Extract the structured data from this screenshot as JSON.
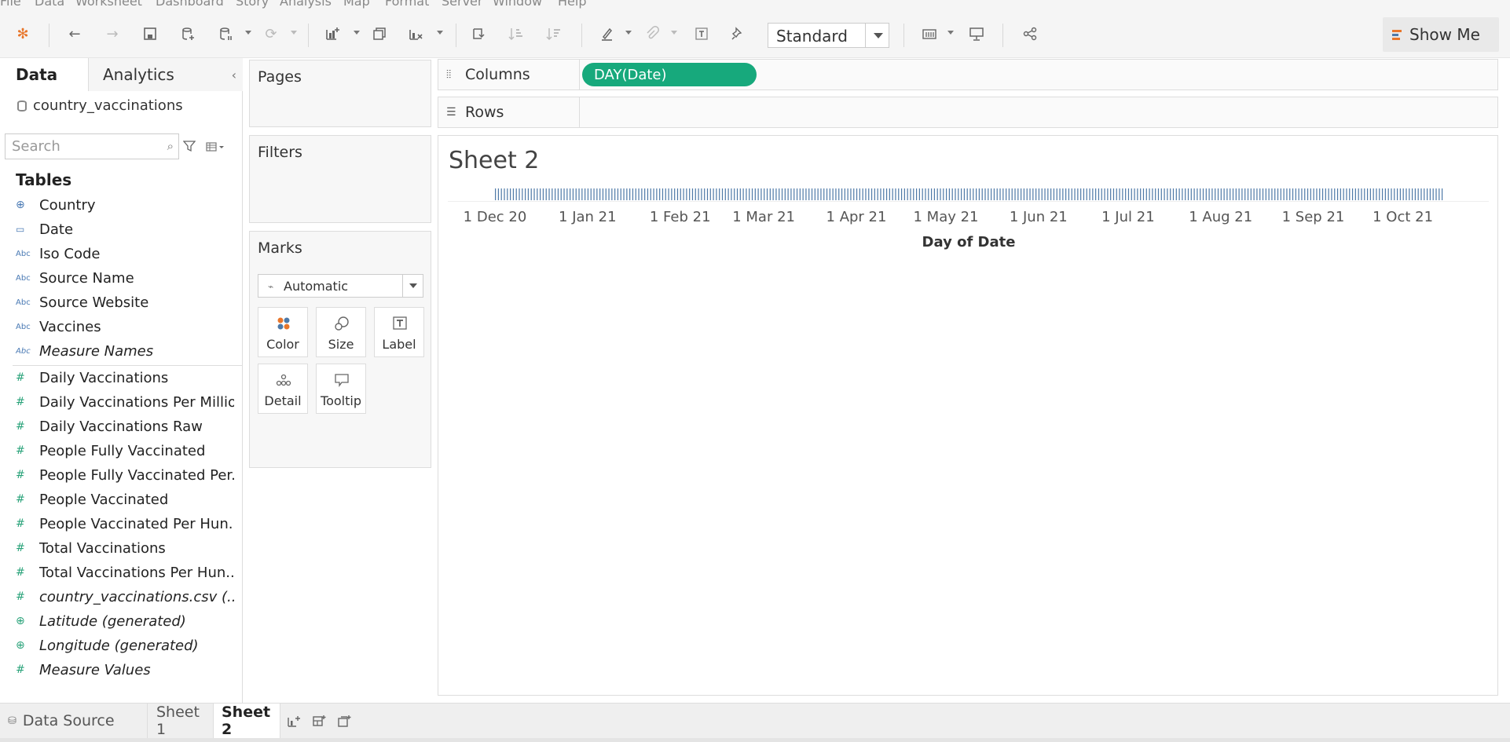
{
  "menu": [
    "File",
    "Data",
    "Worksheet",
    "Dashboard",
    "Story",
    "Analysis",
    "Map",
    "Format",
    "Server",
    "Window",
    "Help"
  ],
  "toolbar": {
    "fit_option": "Standard",
    "show_me_label": "Show Me"
  },
  "data_pane": {
    "tabs": [
      "Data",
      "Analytics"
    ],
    "datasource": "country_vaccinations",
    "search_placeholder": "Search",
    "tables_heading": "Tables",
    "dimensions": [
      {
        "label": "Country",
        "icon": "globe-icon"
      },
      {
        "label": "Date",
        "icon": "calendar-icon"
      },
      {
        "label": "Iso Code",
        "icon": "abc-icon"
      },
      {
        "label": "Source Name",
        "icon": "abc-icon"
      },
      {
        "label": "Source Website",
        "icon": "abc-icon"
      },
      {
        "label": "Vaccines",
        "icon": "abc-icon"
      },
      {
        "label": "Measure Names",
        "icon": "abc-icon",
        "italic": true
      }
    ],
    "measures": [
      {
        "label": "Daily Vaccinations",
        "icon": "number-icon"
      },
      {
        "label": "Daily Vaccinations Per Million",
        "icon": "number-icon"
      },
      {
        "label": "Daily Vaccinations Raw",
        "icon": "number-icon"
      },
      {
        "label": "People Fully Vaccinated",
        "icon": "number-icon"
      },
      {
        "label": "People Fully Vaccinated Per...",
        "icon": "number-icon"
      },
      {
        "label": "People Vaccinated",
        "icon": "number-icon"
      },
      {
        "label": "People Vaccinated Per Hun...",
        "icon": "number-icon"
      },
      {
        "label": "Total Vaccinations",
        "icon": "number-icon"
      },
      {
        "label": "Total Vaccinations Per Hun...",
        "icon": "number-icon"
      },
      {
        "label": "country_vaccinations.csv (...",
        "icon": "number-icon",
        "italic": true
      },
      {
        "label": "Latitude (generated)",
        "icon": "globe-icon",
        "italic": true
      },
      {
        "label": "Longitude (generated)",
        "icon": "globe-icon",
        "italic": true
      },
      {
        "label": "Measure Values",
        "icon": "number-icon",
        "italic": true
      }
    ]
  },
  "cards": {
    "pages": "Pages",
    "filters": "Filters",
    "marks": "Marks",
    "mark_type": "Automatic",
    "mark_buttons": [
      "Color",
      "Size",
      "Label",
      "Detail",
      "Tooltip"
    ]
  },
  "shelves": {
    "columns_label": "Columns",
    "rows_label": "Rows",
    "columns_pill": "DAY(Date)"
  },
  "sheet": {
    "title": "Sheet 2"
  },
  "chart_data": {
    "type": "bar",
    "x_axis_type": "date",
    "x_start": "2020-12-01",
    "x_end": "2021-10-14",
    "mark_color": "#4e79a7",
    "xlabel": "Day of Date",
    "tick_labels": [
      "1 Dec 20",
      "1 Jan 21",
      "1 Feb 21",
      "1 Mar 21",
      "1 Apr 21",
      "1 May 21",
      "1 Jun 21",
      "1 Jul 21",
      "1 Aug 21",
      "1 Sep 21",
      "1 Oct 21"
    ],
    "tick_dates": [
      "2020-12-01",
      "2021-01-01",
      "2021-02-01",
      "2021-03-01",
      "2021-04-01",
      "2021-05-01",
      "2021-06-01",
      "2021-07-01",
      "2021-08-01",
      "2021-09-01",
      "2021-10-01"
    ]
  },
  "bottom_tabs": {
    "data_source": "Data Source",
    "sheets": [
      "Sheet 1",
      "Sheet 2"
    ],
    "active": "Sheet 2"
  },
  "colors": {
    "pill_green": "#17a97c",
    "mark_blue": "#4e79a7",
    "dimension_blue": "#4a7ab4",
    "measure_green": "#2aa37a"
  }
}
